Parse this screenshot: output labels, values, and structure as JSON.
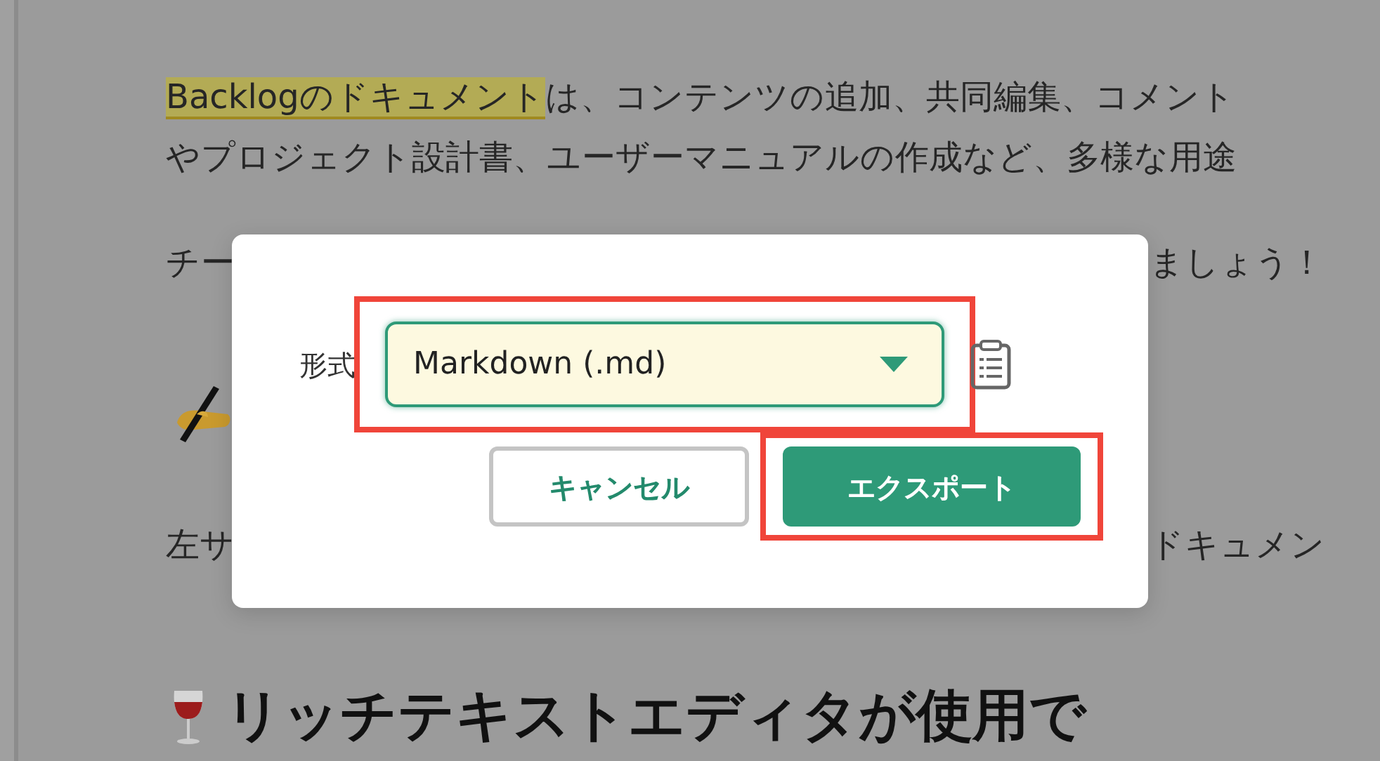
{
  "document": {
    "lines": [
      {
        "kind": "text",
        "parts": [
          {
            "text": "Backlogのドキュメント",
            "highlighted": true
          },
          {
            "text": "は、コンテンツの追加、共同編集、コメント",
            "highlighted": false
          }
        ]
      },
      {
        "kind": "text",
        "parts": [
          {
            "text": "やプロジェクト設計書、ユーザーマニュアルの作成など、多様な用途",
            "highlighted": false
          }
        ]
      },
      {
        "kind": "split",
        "left": "チー",
        "right": "ましょう！"
      },
      {
        "kind": "writing-emoji"
      },
      {
        "kind": "split",
        "left": "左サ",
        "right": "ドキュメン"
      },
      {
        "kind": "heading",
        "text": "リッチテキストエディタが使用で"
      }
    ]
  },
  "dialog": {
    "label": "形式",
    "select": {
      "value": "Markdown (.md)",
      "focused": true,
      "annotated": true
    },
    "buttons": [
      {
        "label": "キャンセル",
        "kind": "secondary",
        "annotated": false
      },
      {
        "label": "エクスポート",
        "kind": "primary",
        "annotated": true
      }
    ]
  }
}
